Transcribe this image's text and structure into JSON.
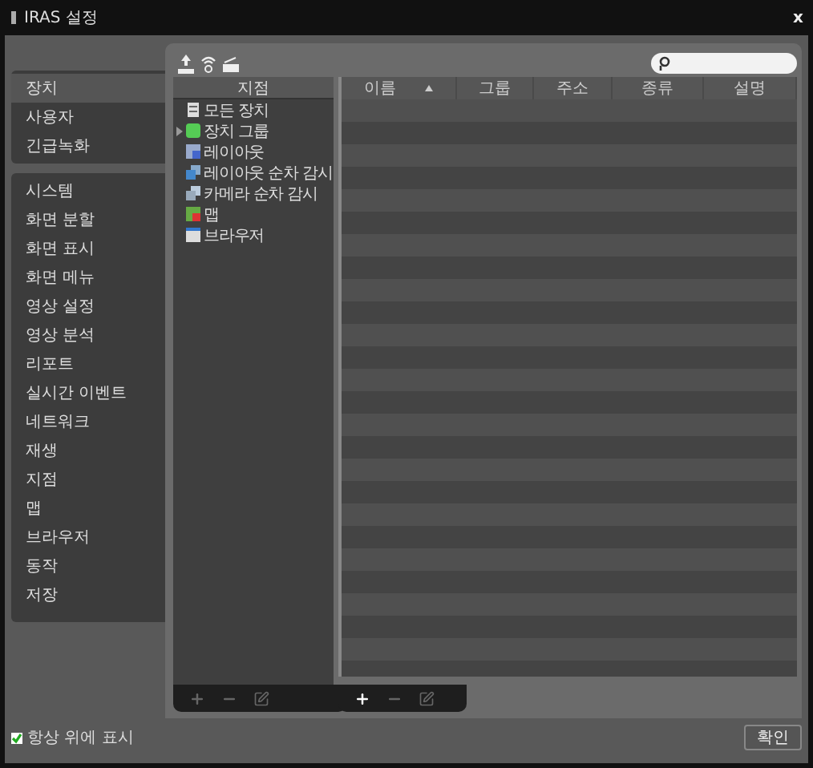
{
  "window": {
    "title": "IRAS 설정",
    "close": "x"
  },
  "sidebar": {
    "groups": [
      {
        "items": [
          {
            "label": "장치",
            "selected": true
          },
          {
            "label": "사용자",
            "selected": false
          },
          {
            "label": "긴급녹화",
            "selected": false
          }
        ]
      },
      {
        "items": [
          {
            "label": "시스템",
            "selected": false
          },
          {
            "label": "화면 분할",
            "selected": false
          },
          {
            "label": "화면 표시",
            "selected": false
          },
          {
            "label": "화면 메뉴",
            "selected": false
          },
          {
            "label": "영상 설정",
            "selected": false
          },
          {
            "label": "영상 분석",
            "selected": false
          },
          {
            "label": "리포트",
            "selected": false
          },
          {
            "label": "실시간 이벤트",
            "selected": false
          },
          {
            "label": "네트워크",
            "selected": false
          },
          {
            "label": "재생",
            "selected": false
          },
          {
            "label": "지점",
            "selected": false
          },
          {
            "label": "맵",
            "selected": false
          },
          {
            "label": "브라우저",
            "selected": false
          },
          {
            "label": "동작",
            "selected": false
          },
          {
            "label": "저장",
            "selected": false
          }
        ]
      }
    ]
  },
  "tree": {
    "header": "지점",
    "items": [
      {
        "label": "모든 장치",
        "kind": "all-devices",
        "expandable": false
      },
      {
        "label": "장치 그룹",
        "kind": "group",
        "expandable": true
      },
      {
        "label": "레이아웃",
        "kind": "layout",
        "expandable": false
      },
      {
        "label": "레이아웃 순차 감시",
        "kind": "layout-sequence",
        "expandable": false
      },
      {
        "label": "카메라 순차 감시",
        "kind": "camera-sequence",
        "expandable": false
      },
      {
        "label": "맵",
        "kind": "map",
        "expandable": false
      },
      {
        "label": "브라우저",
        "kind": "browser",
        "expandable": false
      }
    ],
    "footer": [
      {
        "kind": "add",
        "disabled": true
      },
      {
        "kind": "remove",
        "disabled": true
      },
      {
        "kind": "edit",
        "disabled": true
      }
    ]
  },
  "table": {
    "columns": [
      {
        "label": "이름",
        "sorted": true
      },
      {
        "label": "그룹",
        "sorted": false
      },
      {
        "label": "주소",
        "sorted": false
      },
      {
        "label": "종류",
        "sorted": false
      },
      {
        "label": "설명",
        "sorted": false
      }
    ],
    "footer": [
      {
        "kind": "add",
        "disabled": false
      },
      {
        "kind": "remove",
        "disabled": true
      },
      {
        "kind": "edit",
        "disabled": true
      }
    ]
  },
  "always_on_top": {
    "label": "항상 위에 표시",
    "checked": true
  },
  "ok_button": "확인"
}
